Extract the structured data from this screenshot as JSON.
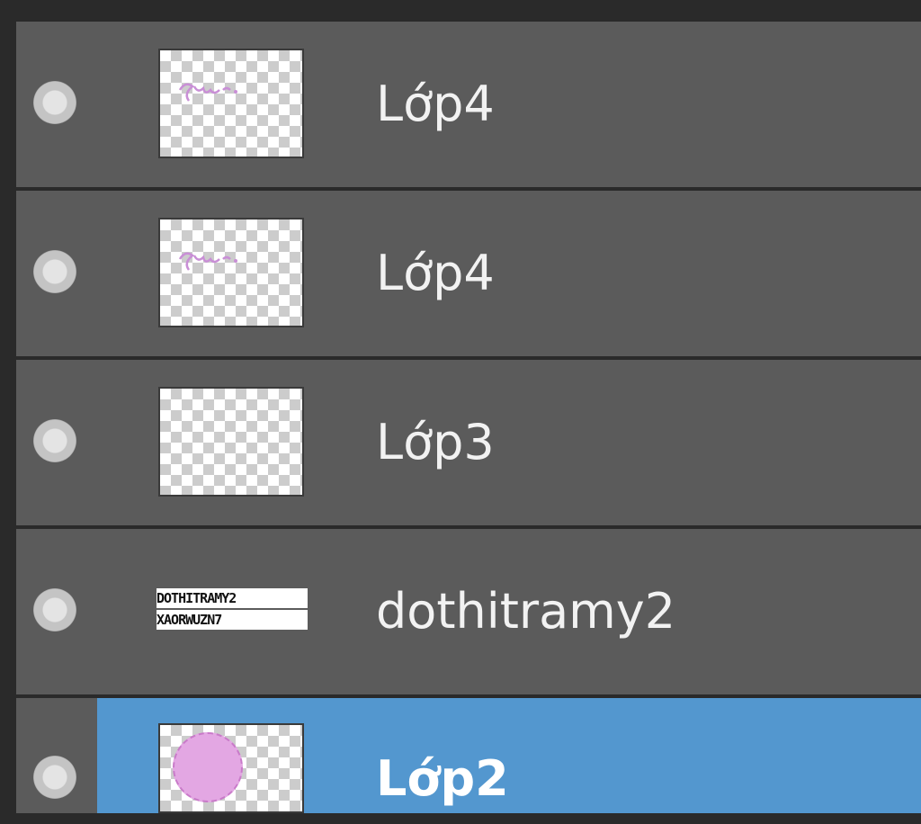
{
  "layers_panel": {
    "layers": [
      {
        "name": "Lớp4",
        "thumbnail": "transparent-with-pink-scribble",
        "selected": false
      },
      {
        "name": "Lớp4",
        "thumbnail": "transparent-with-pink-scribble",
        "selected": false
      },
      {
        "name": "Lớp3",
        "thumbnail": "transparent",
        "selected": false
      },
      {
        "name": "dothitramy2",
        "thumbnail": "text-image",
        "selected": false
      },
      {
        "name": "Lớp2",
        "thumbnail": "pink-circle",
        "selected": true
      }
    ],
    "colors": {
      "row_bg": "#5b5b5b",
      "selected_bg": "#5397cf",
      "panel_bg": "#2a2a2a",
      "text": "#f2f2f2",
      "thumb_scribble": "#c98fd6",
      "thumb_circle": "#e3a7e3"
    },
    "icons": {
      "visibility": "visibility-dot-icon"
    }
  }
}
